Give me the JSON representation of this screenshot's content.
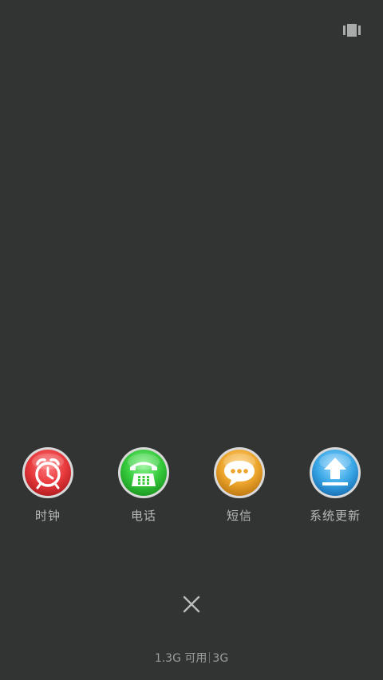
{
  "apps": [
    {
      "label": "时钟",
      "icon": "alarm-clock-icon",
      "color": "#e8393c"
    },
    {
      "label": "电话",
      "icon": "telephone-icon",
      "color": "#35c93b"
    },
    {
      "label": "短信",
      "icon": "chat-bubble-icon",
      "color": "#eda52c"
    },
    {
      "label": "系统更新",
      "icon": "upload-arrow-icon",
      "color": "#3aa7e6"
    }
  ],
  "memory": {
    "available": "1.3G 可用",
    "total": "3G"
  },
  "colors": {
    "background": "#323433",
    "label": "#b7b9b8"
  }
}
